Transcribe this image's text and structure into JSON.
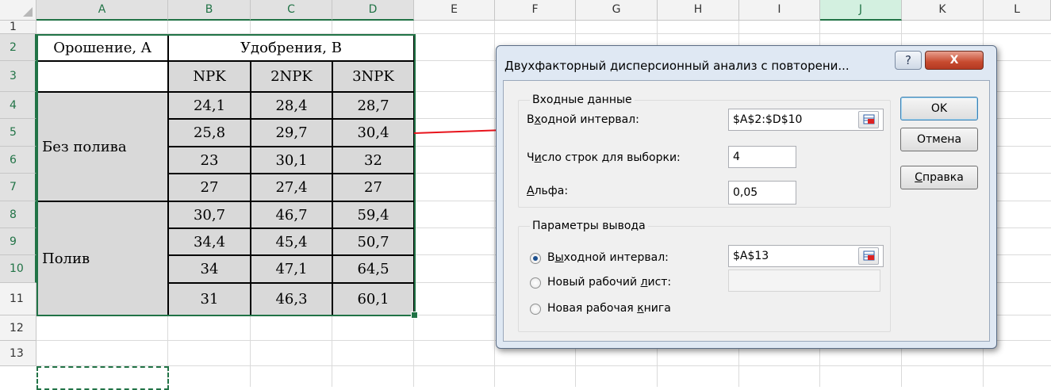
{
  "columns": [
    "A",
    "B",
    "C",
    "D",
    "E",
    "F",
    "G",
    "H",
    "I",
    "J",
    "K",
    "L"
  ],
  "rows": [
    "1",
    "2",
    "3",
    "4",
    "5",
    "6",
    "7",
    "8",
    "9",
    "10",
    "11",
    "12",
    "13"
  ],
  "table": {
    "header_a": "Орошение, A",
    "header_b": "Удобрения, B",
    "subheaders": [
      "NPK",
      "2NPK",
      "3NPK"
    ],
    "group1_label": "Без полива",
    "group2_label": "Полив",
    "values": [
      [
        "24,1",
        "28,4",
        "28,7"
      ],
      [
        "25,8",
        "29,7",
        "30,4"
      ],
      [
        "23",
        "30,1",
        "32"
      ],
      [
        "27",
        "27,4",
        "27"
      ],
      [
        "30,7",
        "46,7",
        "59,4"
      ],
      [
        "34,4",
        "45,4",
        "50,7"
      ],
      [
        "34",
        "47,1",
        "64,5"
      ],
      [
        "31",
        "46,3",
        "60,1"
      ]
    ]
  },
  "dialog": {
    "title": "Двухфакторный дисперсионный анализ с повторени...",
    "help_glyph": "?",
    "close_glyph": "X",
    "input_group": {
      "title": "Входные данные",
      "input_range_label_pre": "В",
      "input_range_label_ul": "х",
      "input_range_label_post": "одной интервал:",
      "input_range_value": "$A$2:$D$10",
      "rows_label_pre": "Ч",
      "rows_label_ul": "и",
      "rows_label_post": "сло строк для выборки:",
      "rows_value": "4",
      "alpha_label_ul": "А",
      "alpha_label_post": "льфа:",
      "alpha_value": "0,05"
    },
    "output_group": {
      "title": "Параметры вывода",
      "output_range_pre": "В",
      "output_range_ul": "ы",
      "output_range_post": "ходной интервал:",
      "output_range_value": "$A$13",
      "new_sheet_pre": "Новый рабочий ",
      "new_sheet_ul": "л",
      "new_sheet_post": "ист:",
      "new_sheet_value": "",
      "new_book_pre": "Новая рабочая ",
      "new_book_ul": "к",
      "new_book_post": "нига",
      "selected": "output_range"
    },
    "buttons": {
      "ok": "OK",
      "cancel": "Отмена",
      "help_ul": "С",
      "help_post": "правка"
    }
  },
  "colors": {
    "accent": "#217346",
    "arrow": "#e8141c",
    "cell_fill": "#d9d9d9",
    "dialog_frame": "#dfe8f3"
  }
}
